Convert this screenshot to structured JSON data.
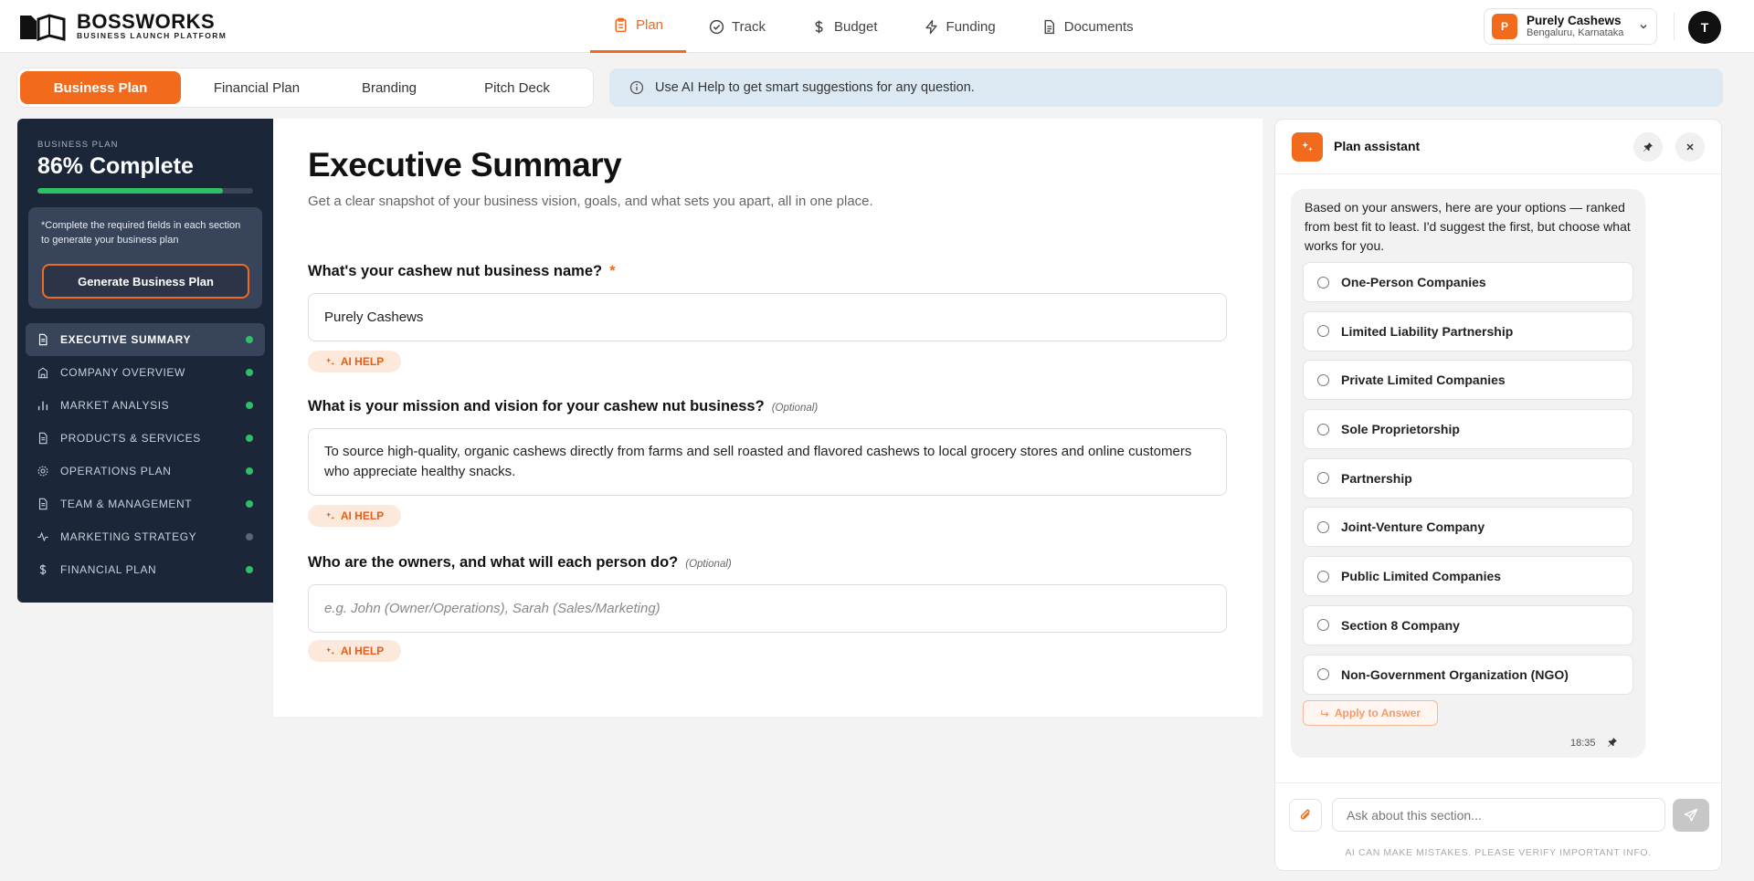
{
  "brand": {
    "name": "BOSSWORKS",
    "tagline": "BUSINESS LAUNCH PLATFORM"
  },
  "nav": [
    {
      "label": "Plan",
      "icon": "clipboard-icon",
      "active": true
    },
    {
      "label": "Track",
      "icon": "check-circle-icon",
      "active": false
    },
    {
      "label": "Budget",
      "icon": "dollar-icon",
      "active": false
    },
    {
      "label": "Funding",
      "icon": "lightning-icon",
      "active": false
    },
    {
      "label": "Documents",
      "icon": "document-icon",
      "active": false
    }
  ],
  "business": {
    "initial": "P",
    "name": "Purely Cashews",
    "location": "Bengaluru, Karnataka"
  },
  "user": {
    "initial": "T"
  },
  "tabs": [
    {
      "label": "Business Plan",
      "active": true
    },
    {
      "label": "Financial Plan",
      "active": false
    },
    {
      "label": "Branding",
      "active": false
    },
    {
      "label": "Pitch Deck",
      "active": false
    }
  ],
  "banner": {
    "text": "Use AI Help to get smart suggestions for any question."
  },
  "sidebar": {
    "kicker": "BUSINESS PLAN",
    "percent_label": "86% Complete",
    "progress": 0.86,
    "note": "*Complete the required fields in each section to generate your business plan",
    "generate_label": "Generate Business Plan",
    "items": [
      {
        "label": "EXECUTIVE SUMMARY",
        "icon": "document-icon",
        "status": "complete",
        "active": true
      },
      {
        "label": "COMPANY OVERVIEW",
        "icon": "building-icon",
        "status": "complete",
        "active": false
      },
      {
        "label": "MARKET ANALYSIS",
        "icon": "bar-chart-icon",
        "status": "complete",
        "active": false
      },
      {
        "label": "PRODUCTS & SERVICES",
        "icon": "document-icon",
        "status": "complete",
        "active": false
      },
      {
        "label": "OPERATIONS PLAN",
        "icon": "gear-icon",
        "status": "complete",
        "active": false
      },
      {
        "label": "TEAM & MANAGEMENT",
        "icon": "document-icon",
        "status": "complete",
        "active": false
      },
      {
        "label": "MARKETING STRATEGY",
        "icon": "activity-icon",
        "status": "incomplete",
        "active": false
      },
      {
        "label": "FINANCIAL PLAN",
        "icon": "dollar-icon",
        "status": "complete",
        "active": false
      }
    ]
  },
  "main": {
    "title": "Executive Summary",
    "subtitle": "Get a clear snapshot of your business vision, goals, and what sets you apart, all in one place.",
    "ai_help_label": "AI HELP",
    "questions": [
      {
        "label": "What's your cashew nut business name?",
        "required_mark": "*",
        "optional_label": "",
        "value": "Purely Cashews",
        "placeholder": ""
      },
      {
        "label": "What is your mission and vision for your cashew nut business?",
        "required_mark": "",
        "optional_label": "(Optional)",
        "value": "To source high-quality, organic cashews directly from farms and sell roasted and flavored cashews to local grocery stores and online customers who appreciate healthy snacks.",
        "placeholder": ""
      },
      {
        "label": "Who are the owners, and what will each person do?",
        "required_mark": "",
        "optional_label": "(Optional)",
        "value": "",
        "placeholder": "e.g. John (Owner/Operations), Sarah (Sales/Marketing)"
      }
    ]
  },
  "assistant": {
    "title": "Plan assistant",
    "message": "Based on your answers, here are your options — ranked from best fit to least. I'd suggest the first, but choose what works for you.",
    "options": [
      "One-Person Companies",
      "Limited Liability Partnership",
      "Private Limited Companies",
      "Sole Proprietorship",
      "Partnership",
      "Joint-Venture Company",
      "Public Limited Companies",
      "Section 8 Company",
      "Non-Government Organization (NGO)"
    ],
    "apply_label": "Apply to Answer",
    "timestamp": "18:35",
    "input_placeholder": "Ask about this section...",
    "disclaimer": "AI CAN MAKE MISTAKES. PLEASE VERIFY IMPORTANT INFO."
  },
  "colors": {
    "accent": "#f26a1b",
    "sidebar_bg": "#1b2638",
    "complete": "#2fbf64",
    "incomplete": "#5b6575"
  }
}
